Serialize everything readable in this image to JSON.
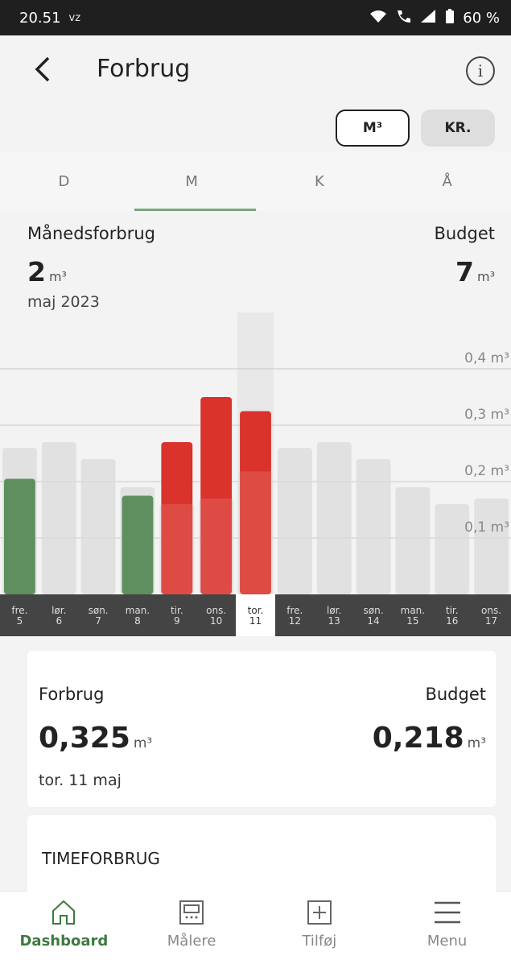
{
  "status": {
    "time": "20.51",
    "carrier_icon": "vz-icon",
    "battery": "60 %"
  },
  "header": {
    "title": "Forbrug"
  },
  "units": {
    "m3": "M³",
    "kr": "KR."
  },
  "tabs": [
    "D",
    "M",
    "K",
    "Å"
  ],
  "summary": {
    "month_label": "Månedsforbrug",
    "month_value": "2",
    "month_unit": "m³",
    "month_period": "maj 2023",
    "budget_label": "Budget",
    "budget_value": "7",
    "budget_unit": "m³"
  },
  "chart_data": {
    "type": "bar",
    "unit": "m³",
    "tick_labels": [
      "0,1 m³",
      "0,2 m³",
      "0,3 m³",
      "0,4 m³"
    ],
    "ylim": [
      0,
      0.5
    ],
    "categories": [
      {
        "day": "fre.",
        "date": "5"
      },
      {
        "day": "lør.",
        "date": "6"
      },
      {
        "day": "søn.",
        "date": "7"
      },
      {
        "day": "man.",
        "date": "8"
      },
      {
        "day": "tir.",
        "date": "9"
      },
      {
        "day": "ons.",
        "date": "10"
      },
      {
        "day": "tor.",
        "date": "11"
      },
      {
        "day": "fre.",
        "date": "12"
      },
      {
        "day": "lør.",
        "date": "13"
      },
      {
        "day": "søn.",
        "date": "14"
      },
      {
        "day": "man.",
        "date": "15"
      },
      {
        "day": "tir.",
        "date": "16"
      },
      {
        "day": "ons.",
        "date": "17"
      }
    ],
    "consumption": [
      0.205,
      null,
      null,
      0.175,
      0.27,
      0.35,
      0.325,
      null,
      null,
      null,
      null,
      null,
      null
    ],
    "budget": [
      0.26,
      0.27,
      0.24,
      0.19,
      0.16,
      0.17,
      0.218,
      0.26,
      0.27,
      0.24,
      0.19,
      0.16,
      0.17
    ],
    "selected_index": 6,
    "colors": {
      "under_budget": "#5f8f5f",
      "over_budget": "#d9332b",
      "budget": "#dcdcdc"
    }
  },
  "detail": {
    "consumption_label": "Forbrug",
    "consumption_value": "0,325",
    "consumption_unit": "m³",
    "budget_label": "Budget",
    "budget_value": "0,218",
    "budget_unit": "m³",
    "date": "tor. 11 maj"
  },
  "hourly": {
    "title": "TIMEFORBRUG"
  },
  "nav": [
    {
      "label": "Dashboard",
      "icon": "home-icon"
    },
    {
      "label": "Målere",
      "icon": "meter-icon"
    },
    {
      "label": "Tilføj",
      "icon": "add-icon"
    },
    {
      "label": "Menu",
      "icon": "menu-icon"
    }
  ]
}
